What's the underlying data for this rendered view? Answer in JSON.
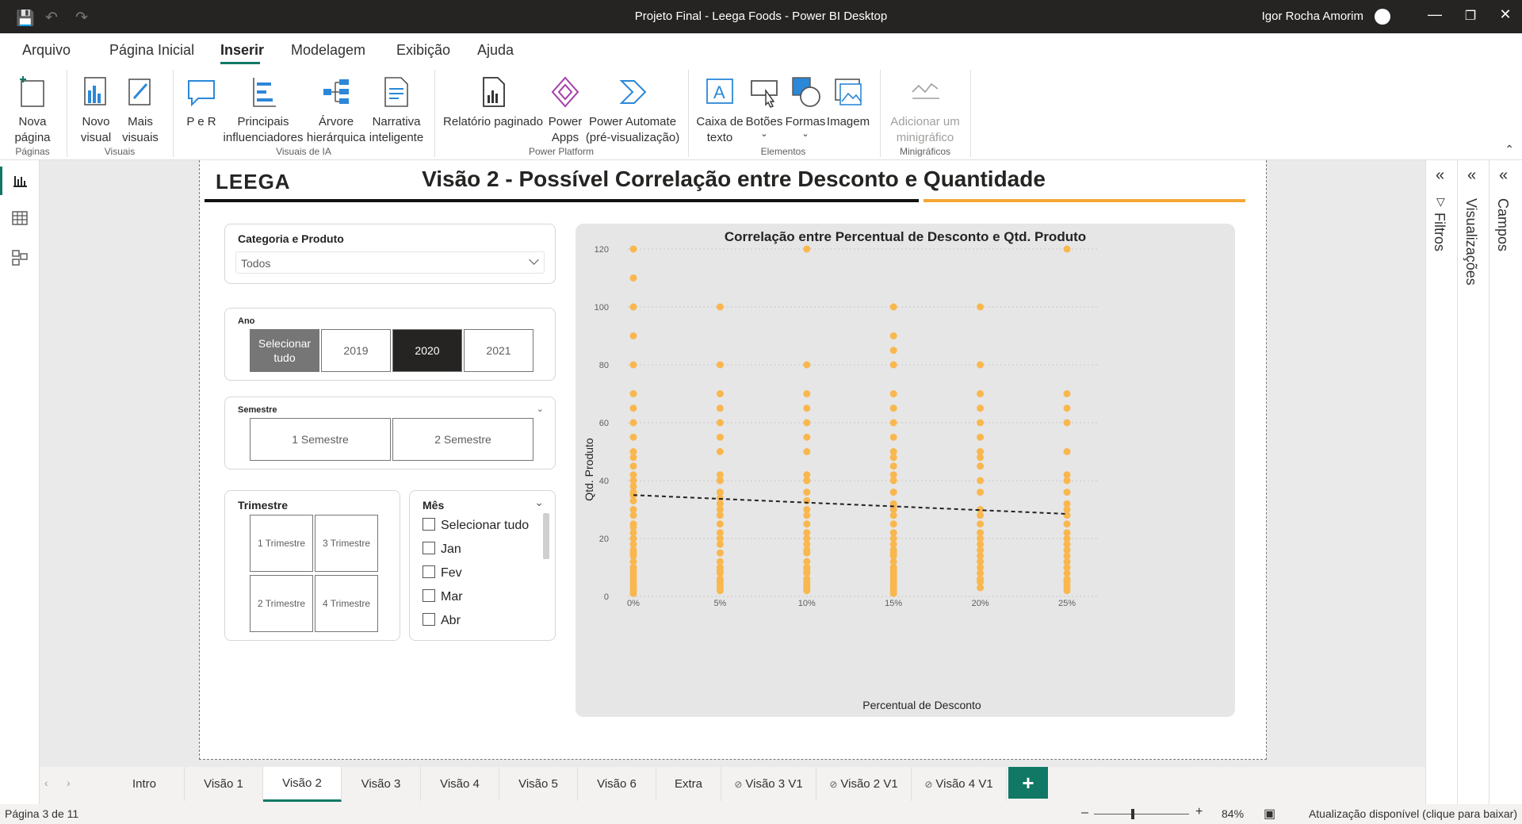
{
  "window": {
    "title": "Projeto Final - Leega Foods - Power BI Desktop",
    "user": "Igor Rocha Amorim"
  },
  "menu": {
    "tabs": [
      {
        "label": "Arquivo"
      },
      {
        "label": "Página Inicial"
      },
      {
        "label": "Inserir",
        "active": true
      },
      {
        "label": "Modelagem"
      },
      {
        "label": "Exibição"
      },
      {
        "label": "Ajuda"
      }
    ]
  },
  "ribbon": {
    "nova_pagina": "Nova página",
    "novo_visual": "Novo visual",
    "mais_visuais": "Mais visuais",
    "pe_r": "P e R",
    "principais": "Principais influenciadores",
    "arvore": "Árvore hierárquica",
    "narrativa": "Narrativa inteligente",
    "relatorio": "Relatório paginado",
    "power_apps": "Power Apps",
    "power_automate": "Power Automate (pré-visualização)",
    "caixa_texto": "Caixa de texto",
    "botoes": "Botões",
    "formas": "Formas",
    "imagem": "Imagem",
    "minigrafico": "Adicionar um minigráfico",
    "groups": {
      "paginas": "Páginas",
      "visuais": "Visuais",
      "ia": "Visuais de IA",
      "power_platform": "Power Platform",
      "elementos": "Elementos",
      "minigraficos": "Minigráficos"
    }
  },
  "report": {
    "logo": "LEEGA",
    "title": "Visão 2 - Possível Correlação entre Desconto e Quantidade",
    "slicer_categoria": {
      "label": "Categoria e Produto",
      "value": "Todos"
    },
    "slicer_ano": {
      "label": "Ano",
      "options": [
        "Selecionar tudo",
        "2019",
        "2020",
        "2021"
      ],
      "selected": "2020"
    },
    "slicer_semestre": {
      "label": "Semestre",
      "options": [
        "1 Semestre",
        "2 Semestre"
      ]
    },
    "slicer_trimestre": {
      "label": "Trimestre",
      "options": [
        "1 Trimestre",
        "3 Trimestre",
        "2 Trimestre",
        "4 Trimestre"
      ]
    },
    "slicer_mes": {
      "label": "Mês",
      "options": [
        "Selecionar tudo",
        "Jan",
        "Fev",
        "Mar",
        "Abr"
      ]
    }
  },
  "chart_data": {
    "type": "scatter",
    "title": "Correlação entre Percentual de Desconto e Qtd. Produto",
    "xlabel": "Percentual de Desconto",
    "ylabel": "Qtd. Produto",
    "x_categories": [
      "0%",
      "5%",
      "10%",
      "15%",
      "20%",
      "25%"
    ],
    "yticks": [
      0,
      20,
      40,
      60,
      80,
      100,
      120
    ],
    "ylim": [
      0,
      120
    ],
    "grid": true,
    "point_color": "#f9b74e",
    "trend_line": {
      "y_start": 35,
      "y_end": 28.5
    },
    "series": [
      {
        "x": "0%",
        "y": [
          120,
          110,
          100,
          90,
          80,
          70,
          65,
          60,
          55,
          50,
          48,
          45,
          42,
          40,
          38,
          36,
          35,
          33,
          30,
          28,
          25,
          24,
          22,
          20,
          18,
          16,
          15,
          14,
          12,
          10,
          9,
          8,
          7,
          6,
          5,
          4,
          3,
          2,
          1
        ]
      },
      {
        "x": "5%",
        "y": [
          100,
          80,
          70,
          65,
          60,
          55,
          50,
          42,
          40,
          36,
          34,
          32,
          30,
          28,
          25,
          22,
          20,
          18,
          15,
          12,
          10,
          9,
          8,
          6,
          5,
          4,
          3,
          2
        ]
      },
      {
        "x": "10%",
        "y": [
          120,
          80,
          70,
          65,
          60,
          55,
          50,
          42,
          40,
          36,
          33,
          30,
          28,
          25,
          22,
          20,
          18,
          16,
          15,
          12,
          10,
          9,
          8,
          6,
          5,
          4,
          3,
          2
        ]
      },
      {
        "x": "15%",
        "y": [
          100,
          90,
          85,
          80,
          70,
          65,
          60,
          55,
          50,
          48,
          45,
          42,
          40,
          36,
          32,
          30,
          28,
          25,
          22,
          20,
          18,
          16,
          15,
          14,
          12,
          10,
          9,
          8,
          7,
          6,
          5,
          4,
          3,
          2,
          1
        ]
      },
      {
        "x": "20%",
        "y": [
          100,
          80,
          70,
          65,
          60,
          55,
          50,
          48,
          45,
          40,
          36,
          30,
          28,
          25,
          22,
          20,
          18,
          16,
          14,
          12,
          10,
          8,
          6,
          5,
          3
        ]
      },
      {
        "x": "25%",
        "y": [
          120,
          70,
          65,
          60,
          50,
          42,
          40,
          36,
          32,
          30,
          28,
          25,
          22,
          20,
          18,
          16,
          14,
          12,
          10,
          8,
          6,
          5,
          4,
          3,
          2
        ]
      }
    ]
  },
  "right_panels": {
    "filtros": "Filtros",
    "visualizacoes": "Visualizações",
    "campos": "Campos"
  },
  "page_tabs": [
    {
      "label": "Intro"
    },
    {
      "label": "Visão 1"
    },
    {
      "label": "Visão 2",
      "active": true
    },
    {
      "label": "Visão 3"
    },
    {
      "label": "Visão 4"
    },
    {
      "label": "Visão 5"
    },
    {
      "label": "Visão 6"
    },
    {
      "label": "Extra"
    },
    {
      "label": "Visão 3 V1",
      "hidden": true
    },
    {
      "label": "Visão 2 V1",
      "hidden": true
    },
    {
      "label": "Visão 4 V1",
      "hidden": true
    }
  ],
  "status": {
    "page": "Página 3 de 11",
    "zoom": "84%",
    "update": "Atualização disponível (clique para baixar)"
  }
}
